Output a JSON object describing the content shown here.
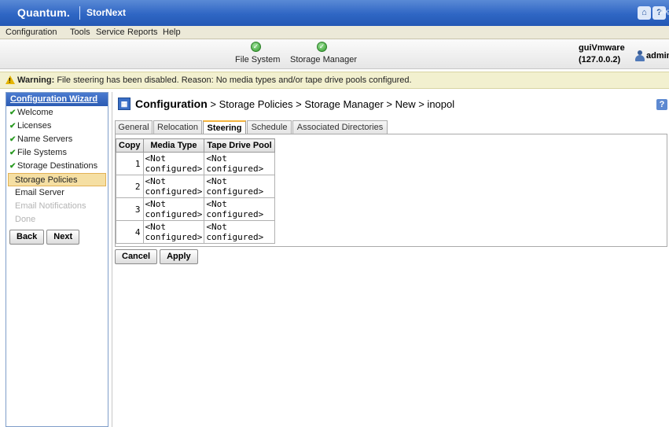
{
  "header": {
    "brand": "Quantum.",
    "product": "StorNext",
    "logoff_label": "Log Off",
    "icons": [
      "home-icon",
      "help-icon"
    ]
  },
  "menu": [
    "Configuration",
    "Tools",
    "Service",
    "Reports",
    "Help"
  ],
  "status": {
    "items": [
      {
        "label": "File System",
        "state": "ok"
      },
      {
        "label": "Storage Manager",
        "state": "ok"
      }
    ],
    "host": "guiVmware",
    "ip": "(127.0.0.2)",
    "user": "admin"
  },
  "warning": {
    "prefix": "Warning:",
    "message": "File steering has been disabled. Reason: No media types and/or tape drive pools configured."
  },
  "wizard": {
    "title": "Configuration Wizard",
    "items": [
      {
        "label": "Welcome",
        "state": "done"
      },
      {
        "label": "Licenses",
        "state": "done"
      },
      {
        "label": "Name Servers",
        "state": "done"
      },
      {
        "label": "File Systems",
        "state": "done"
      },
      {
        "label": "Storage Destinations",
        "state": "done"
      },
      {
        "label": "Storage Policies",
        "state": "active"
      },
      {
        "label": "Email Server",
        "state": "pending"
      },
      {
        "label": "Email Notifications",
        "state": "disabled"
      },
      {
        "label": "Done",
        "state": "disabled"
      }
    ],
    "back_label": "Back",
    "next_label": "Next"
  },
  "page": {
    "title_strong": "Configuration",
    "breadcrumb": " > Storage Policies > Storage Manager > New > inopol",
    "help": "?"
  },
  "tabs": [
    "General",
    "Relocation",
    "Steering",
    "Schedule",
    "Associated Directories"
  ],
  "active_tab": "Steering",
  "steering": {
    "headers": [
      "Copy",
      "Media Type",
      "Tape Drive Pool"
    ],
    "rows": [
      {
        "copy": "1",
        "media_type": "<Not configured>",
        "tape_pool": "<Not configured>"
      },
      {
        "copy": "2",
        "media_type": "<Not configured>",
        "tape_pool": "<Not configured>"
      },
      {
        "copy": "3",
        "media_type": "<Not configured>",
        "tape_pool": "<Not configured>"
      },
      {
        "copy": "4",
        "media_type": "<Not configured>",
        "tape_pool": "<Not configured>"
      }
    ]
  },
  "actions": {
    "cancel_label": "Cancel",
    "apply_label": "Apply"
  },
  "colors": {
    "titlebar": "#2f66c4",
    "warning_bg": "#f2f0cf",
    "active_tab_accent": "#f3b33d",
    "check_green": "#2a9a22",
    "wizard_active_bg": "#f5dfa3"
  }
}
